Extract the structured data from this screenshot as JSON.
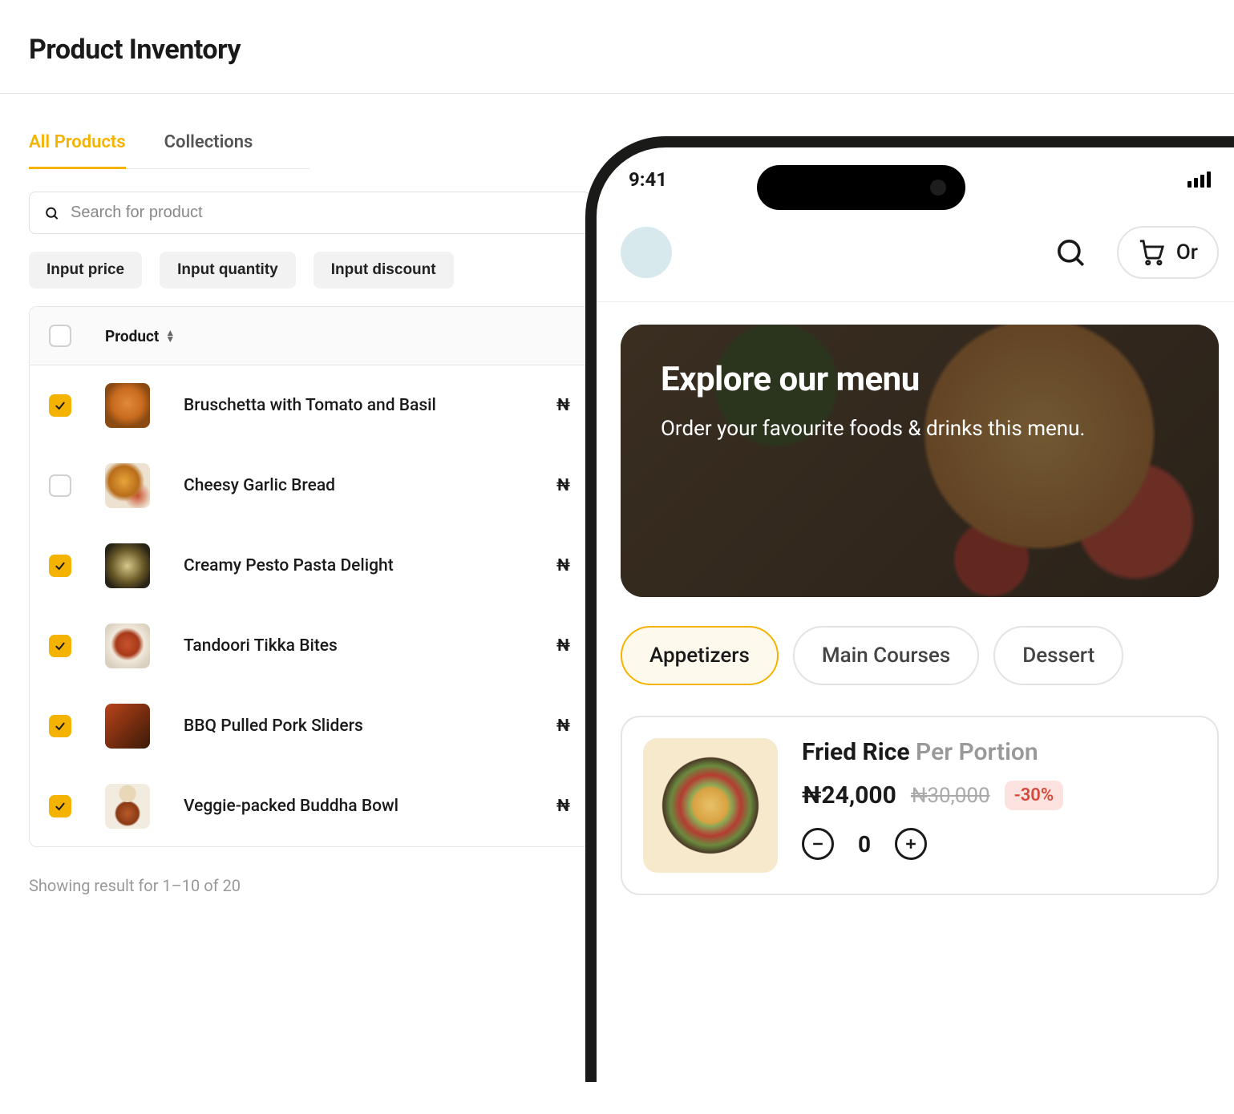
{
  "page_title": "Product Inventory",
  "tabs": [
    {
      "label": "All Products",
      "active": true
    },
    {
      "label": "Collections",
      "active": false
    }
  ],
  "search": {
    "placeholder": "Search for product"
  },
  "actions": [
    {
      "label": "Input price"
    },
    {
      "label": "Input quantity"
    },
    {
      "label": "Input discount"
    }
  ],
  "table": {
    "header": "Product",
    "currency_prefix": "₦",
    "rows": [
      {
        "name": "Bruschetta with Tomato and Basil",
        "checked": true
      },
      {
        "name": "Cheesy Garlic Bread",
        "checked": false
      },
      {
        "name": "Creamy Pesto Pasta Delight",
        "checked": true
      },
      {
        "name": "Tandoori Tikka Bites",
        "checked": true
      },
      {
        "name": "BBQ Pulled Pork Sliders",
        "checked": true
      },
      {
        "name": "Veggie-packed Buddha Bowl",
        "checked": true
      }
    ]
  },
  "pager": "Showing result for 1–10 of 20",
  "phone": {
    "time": "9:41",
    "order_chip": "Or",
    "hero_title": "Explore our menu",
    "hero_sub": "Order your favourite foods & drinks this menu.",
    "categories": [
      {
        "label": "Appetizers",
        "active": true
      },
      {
        "label": "Main Courses",
        "active": false
      },
      {
        "label": "Dessert",
        "active": false
      }
    ],
    "dish": {
      "name": "Fried Rice",
      "unit": "Per Portion",
      "price": "₦24,000",
      "old_price": "₦30,000",
      "discount": "-30%",
      "qty": "0"
    }
  }
}
